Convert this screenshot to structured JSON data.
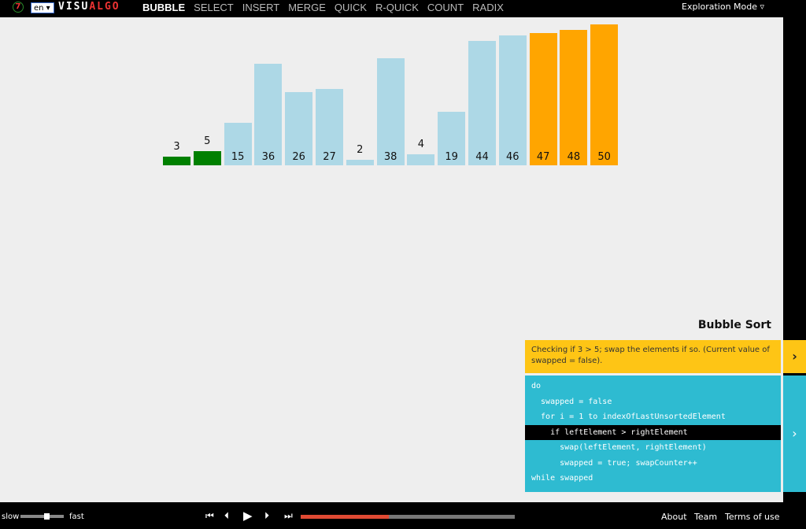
{
  "topbar": {
    "logo_badge": "7",
    "language": "en ▾",
    "brand_a": "VISU",
    "brand_b": "ALGO",
    "nav": [
      {
        "label": "BUBBLE",
        "active": true
      },
      {
        "label": "SELECT"
      },
      {
        "label": "INSERT"
      },
      {
        "label": "MERGE"
      },
      {
        "label": "QUICK"
      },
      {
        "label": "R-QUICK"
      },
      {
        "label": "COUNT"
      },
      {
        "label": "RADIX"
      }
    ],
    "mode": "Exploration Mode ▿"
  },
  "array": {
    "values": [
      3,
      5,
      15,
      36,
      26,
      27,
      2,
      38,
      4,
      19,
      44,
      46,
      47,
      48,
      50
    ],
    "states": [
      "compare",
      "compare",
      "default",
      "default",
      "default",
      "default",
      "default",
      "default",
      "default",
      "default",
      "default",
      "default",
      "sorted",
      "sorted",
      "sorted"
    ],
    "colors": {
      "default": "#add8e6",
      "compare": "#008000",
      "sorted": "#ffa500"
    }
  },
  "panel": {
    "title": "Bubble Sort",
    "status": "Checking if 3 > 5; swap the elements if so. (Current value of swapped = false).",
    "code": [
      "do",
      "  swapped = false",
      "  for i = 1 to indexOfLastUnsortedElement",
      "    if leftElement > rightElement",
      "      swap(leftElement, rightElement)",
      "      swapped = true; swapCounter++",
      "while swapped"
    ],
    "highlighted_line": 3
  },
  "footer": {
    "slow": "slow",
    "fast": "fast",
    "speed": 0.6,
    "progress": 0.41,
    "links": [
      "About",
      "Team",
      "Terms of use"
    ]
  }
}
